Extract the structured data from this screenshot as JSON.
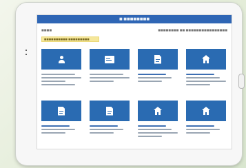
{
  "device": {
    "name": "tablet",
    "screen_bg": "#ffffff",
    "accent": "#2a6bb2",
    "topbar_color": "#2f66b5"
  },
  "app": {
    "title": "■ ■■■■■■■■"
  },
  "header": {
    "left_text": "■■■■",
    "right_text": "■■■■■■■■ ■■ ■■■■■■■■■■■■■■■■"
  },
  "notice": {
    "text": "■■■■■■■■■■ ■■■■■■■■■"
  },
  "tiles": [
    {
      "icon": "person-icon",
      "label": "■■■■■■■■"
    },
    {
      "icon": "id-card-icon",
      "label": "■■■■■■■■"
    },
    {
      "icon": "document-icon",
      "label": "■■■■■■■■"
    },
    {
      "icon": "house-icon",
      "label": "■■■■■■■■"
    },
    {
      "icon": "document-icon",
      "label": "■■■■■■■■"
    },
    {
      "icon": "document-icon",
      "label": "■■■■■■■■"
    },
    {
      "icon": "house-icon",
      "label": "■■■■■■■■"
    },
    {
      "icon": "house-icon",
      "label": "■■■■■■■■"
    }
  ]
}
